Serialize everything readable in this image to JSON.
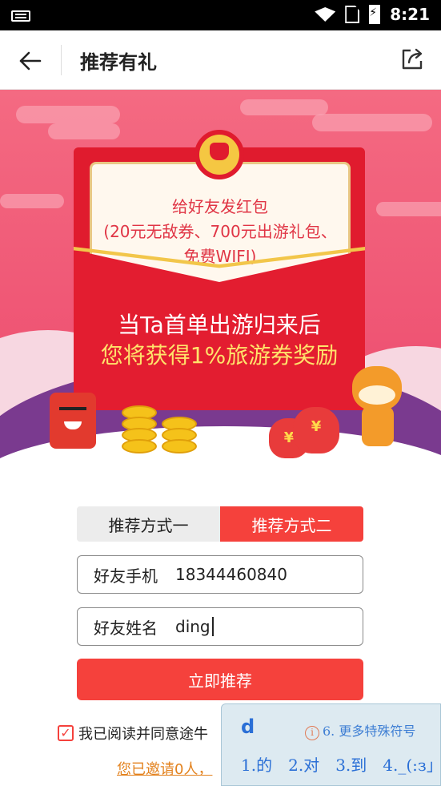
{
  "status_bar": {
    "time": "8:21"
  },
  "header": {
    "title": "推荐有礼"
  },
  "banner": {
    "card_line1": "给好友发红包",
    "card_line2": "(20元无敌券、700元出游礼包、",
    "card_line3": "免费WIFI)",
    "headline1": "当Ta首单出游归来后",
    "headline2": "您将获得1%旅游券奖励",
    "coin_symbol": "¥"
  },
  "tabs": [
    {
      "label": "推荐方式一",
      "active": false
    },
    {
      "label": "推荐方式二",
      "active": true
    }
  ],
  "form": {
    "phone_label": "好友手机",
    "phone_value": "18344460840",
    "name_label": "好友姓名",
    "name_value": "ding",
    "submit_label": "立即推荐"
  },
  "agreement": {
    "text": "我已阅读并同意途牛",
    "checked": true
  },
  "invited_text": "您已邀请0人，",
  "ime": {
    "input": "d",
    "hint_text": "6. 更多特殊符号",
    "candidates": [
      "1.的",
      "2.对",
      "3.到",
      "4._(:з」"
    ]
  },
  "colors": {
    "accent_red": "#f5413c",
    "banner_pink": "#ef5574",
    "link_orange": "#e3821e"
  }
}
